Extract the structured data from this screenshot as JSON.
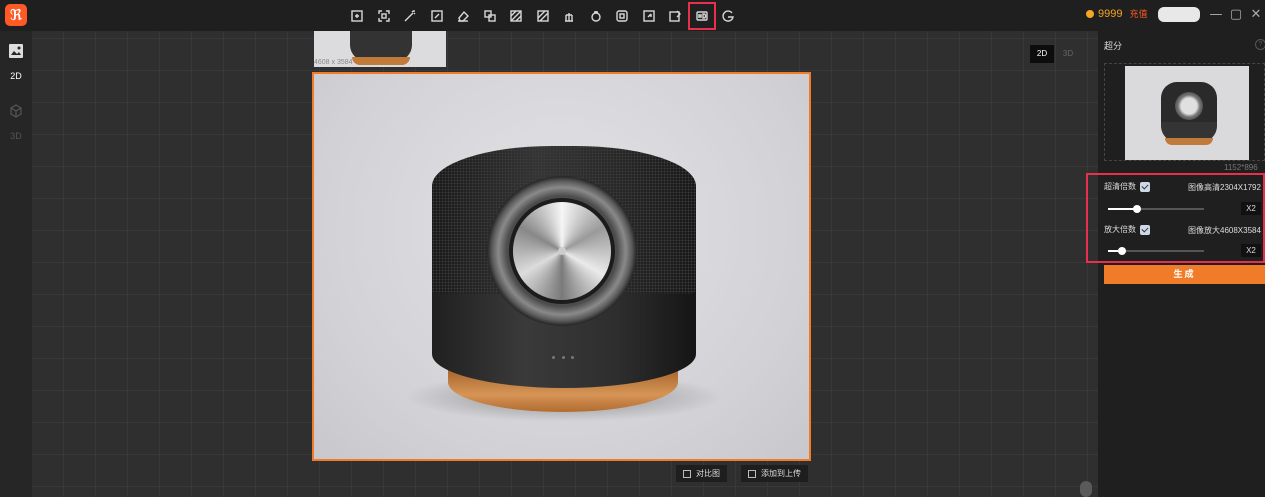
{
  "app": {
    "logo_glyph": "ꝏ"
  },
  "toolbar": {
    "icons": [
      "crop-icon",
      "scan-icon",
      "magic-wand-icon",
      "brush-edit-icon",
      "eraser-icon",
      "replace-icon",
      "texture-icon",
      "pattern-icon",
      "light-icon",
      "rotate-icon",
      "layers-icon",
      "expand-icon",
      "image-edit-icon",
      "hd-upscale-icon",
      "g-icon"
    ],
    "active": "hd-upscale-icon"
  },
  "account": {
    "coins": "9999",
    "recharge_label": "充值"
  },
  "window": {
    "minimize": "—",
    "maximize": "▢",
    "close": "✕"
  },
  "leftbar": {
    "mode_2d": "2D",
    "mode_3d": "3D"
  },
  "canvas": {
    "top_thumb_size": "4608 x 3584",
    "view_2d": "2D",
    "view_3d": "3D",
    "compare_label": "对比图",
    "add_upload_label": "添加到上传"
  },
  "panel": {
    "title": "超分",
    "help": "?",
    "source_resolution": "1152*896",
    "hd_label": "超清倍数",
    "hd_info": "图像高清2304X1792",
    "hd_multiplier": "X2",
    "hd_level": 0.3,
    "scale_label": "放大倍数",
    "scale_info": "图像放大4608X3584",
    "scale_multiplier": "X2",
    "scale_level": 0.15,
    "generate_label": "生成"
  },
  "colors": {
    "accent": "#f07c29",
    "highlight": "#e8304d",
    "coin": "#f5a623"
  }
}
